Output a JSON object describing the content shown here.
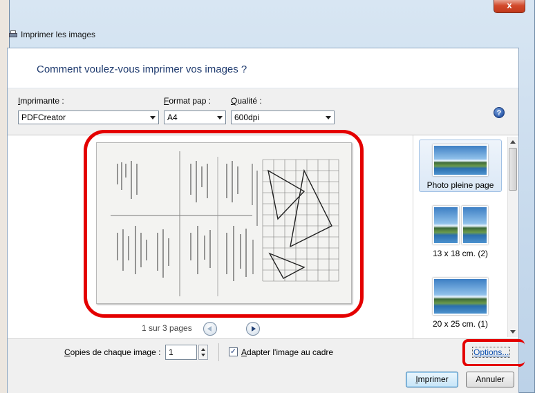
{
  "window": {
    "title": "Imprimer les images",
    "close_glyph": "x"
  },
  "header": {
    "heading": "Comment voulez-vous imprimer vos images ?"
  },
  "controls": {
    "printer_label_accel": "I",
    "printer_label_rest": "mprimante :",
    "printer_value": "PDFCreator",
    "paper_label_accel": "F",
    "paper_label_rest": "ormat pap :",
    "paper_value": "A4",
    "quality_label_accel": "Q",
    "quality_label_rest": "ualité :",
    "quality_value": "600dpi",
    "help_glyph": "?"
  },
  "preview": {
    "page_indicator": "1 sur 3 pages"
  },
  "layouts": [
    {
      "label": "Photo pleine page",
      "selected": true
    },
    {
      "label": "13 x 18 cm. (2)",
      "selected": false
    },
    {
      "label": "20 x 25 cm. (1)",
      "selected": false
    }
  ],
  "options_bar": {
    "copies_label_accel": "C",
    "copies_label_rest": "opies de chaque image :",
    "copies_value": "1",
    "fit_checked_glyph": "✓",
    "fit_label_accel": "A",
    "fit_label_rest": "dapter l'image au cadre",
    "options_link": "Options..."
  },
  "footer": {
    "print_accel": "I",
    "print_rest": "mprimer",
    "cancel": "Annuler"
  },
  "colors": {
    "highlight": "#e40000",
    "heading": "#1e3a6e",
    "link": "#0b4fb0"
  }
}
